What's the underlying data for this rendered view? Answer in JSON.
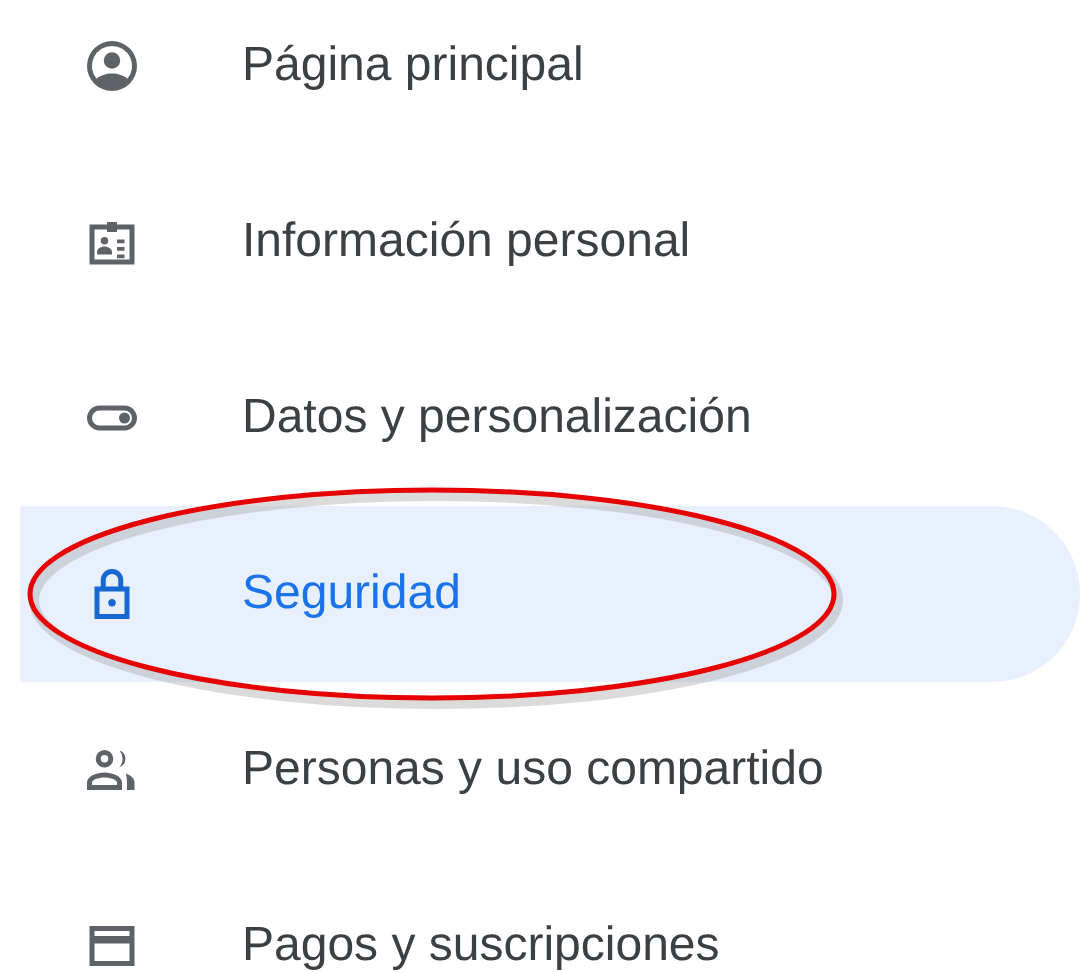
{
  "nav_items": [
    {
      "label": "Página principal",
      "selected": false
    },
    {
      "label": "Información personal",
      "selected": false
    },
    {
      "label": "Datos y personalización",
      "selected": false
    },
    {
      "label": "Seguridad",
      "selected": true
    },
    {
      "label": "Personas y uso compartido",
      "selected": false
    },
    {
      "label": "Pagos y suscripciones",
      "selected": false
    }
  ]
}
